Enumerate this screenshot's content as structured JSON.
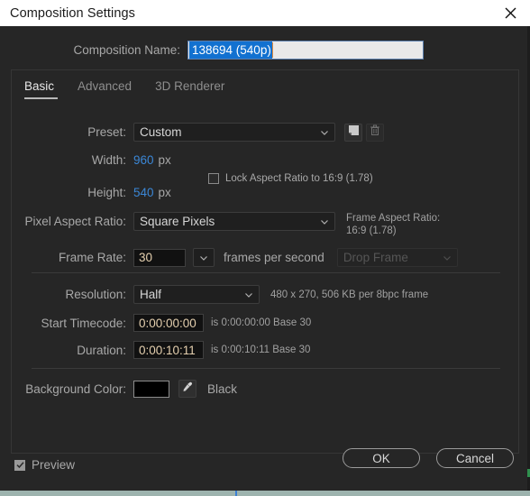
{
  "window": {
    "title": "Composition Settings",
    "close_icon": "close-icon"
  },
  "composition_name": {
    "label": "Composition Name:",
    "value": "138694 (540p)"
  },
  "tabs": [
    {
      "label": "Basic",
      "active": true
    },
    {
      "label": "Advanced",
      "active": false
    },
    {
      "label": "3D Renderer",
      "active": false
    }
  ],
  "preset": {
    "label": "Preset:",
    "value": "Custom",
    "save_icon": "save-preset-icon",
    "delete_icon": "trash-icon"
  },
  "width": {
    "label": "Width:",
    "value": "960",
    "unit": "px"
  },
  "height": {
    "label": "Height:",
    "value": "540",
    "unit": "px"
  },
  "lock_aspect": {
    "label": "Lock Aspect Ratio to 16:9 (1.78)",
    "checked": false
  },
  "pixel_aspect_ratio": {
    "label": "Pixel Aspect Ratio:",
    "value": "Square Pixels"
  },
  "frame_aspect_ratio": {
    "label": "Frame Aspect Ratio:",
    "value": "16:9 (1.78)"
  },
  "frame_rate": {
    "label": "Frame Rate:",
    "value": "30",
    "unit": "frames per second",
    "drop_frame": "Drop Frame"
  },
  "resolution": {
    "label": "Resolution:",
    "value": "Half",
    "info": "480 x 270, 506 KB per 8bpc frame"
  },
  "start_timecode": {
    "label": "Start Timecode:",
    "value": "0:00:00:00",
    "info": "is 0:00:00:00  Base 30"
  },
  "duration": {
    "label": "Duration:",
    "value": "0:00:10:11",
    "info": "is 0:00:10:11  Base 30"
  },
  "background_color": {
    "label": "Background Color:",
    "swatch": "#000000",
    "eyedropper_icon": "eyedropper-icon",
    "name": "Black"
  },
  "footer": {
    "preview_label": "Preview",
    "preview_checked": true,
    "ok_label": "OK",
    "cancel_label": "Cancel"
  },
  "colors": {
    "titlebar_bg": "#ffffff",
    "dialog_bg": "#262626",
    "selection_blue": "#1271d0",
    "value_blue": "#3b87d6",
    "numeric_amber": "#e4cfae"
  }
}
